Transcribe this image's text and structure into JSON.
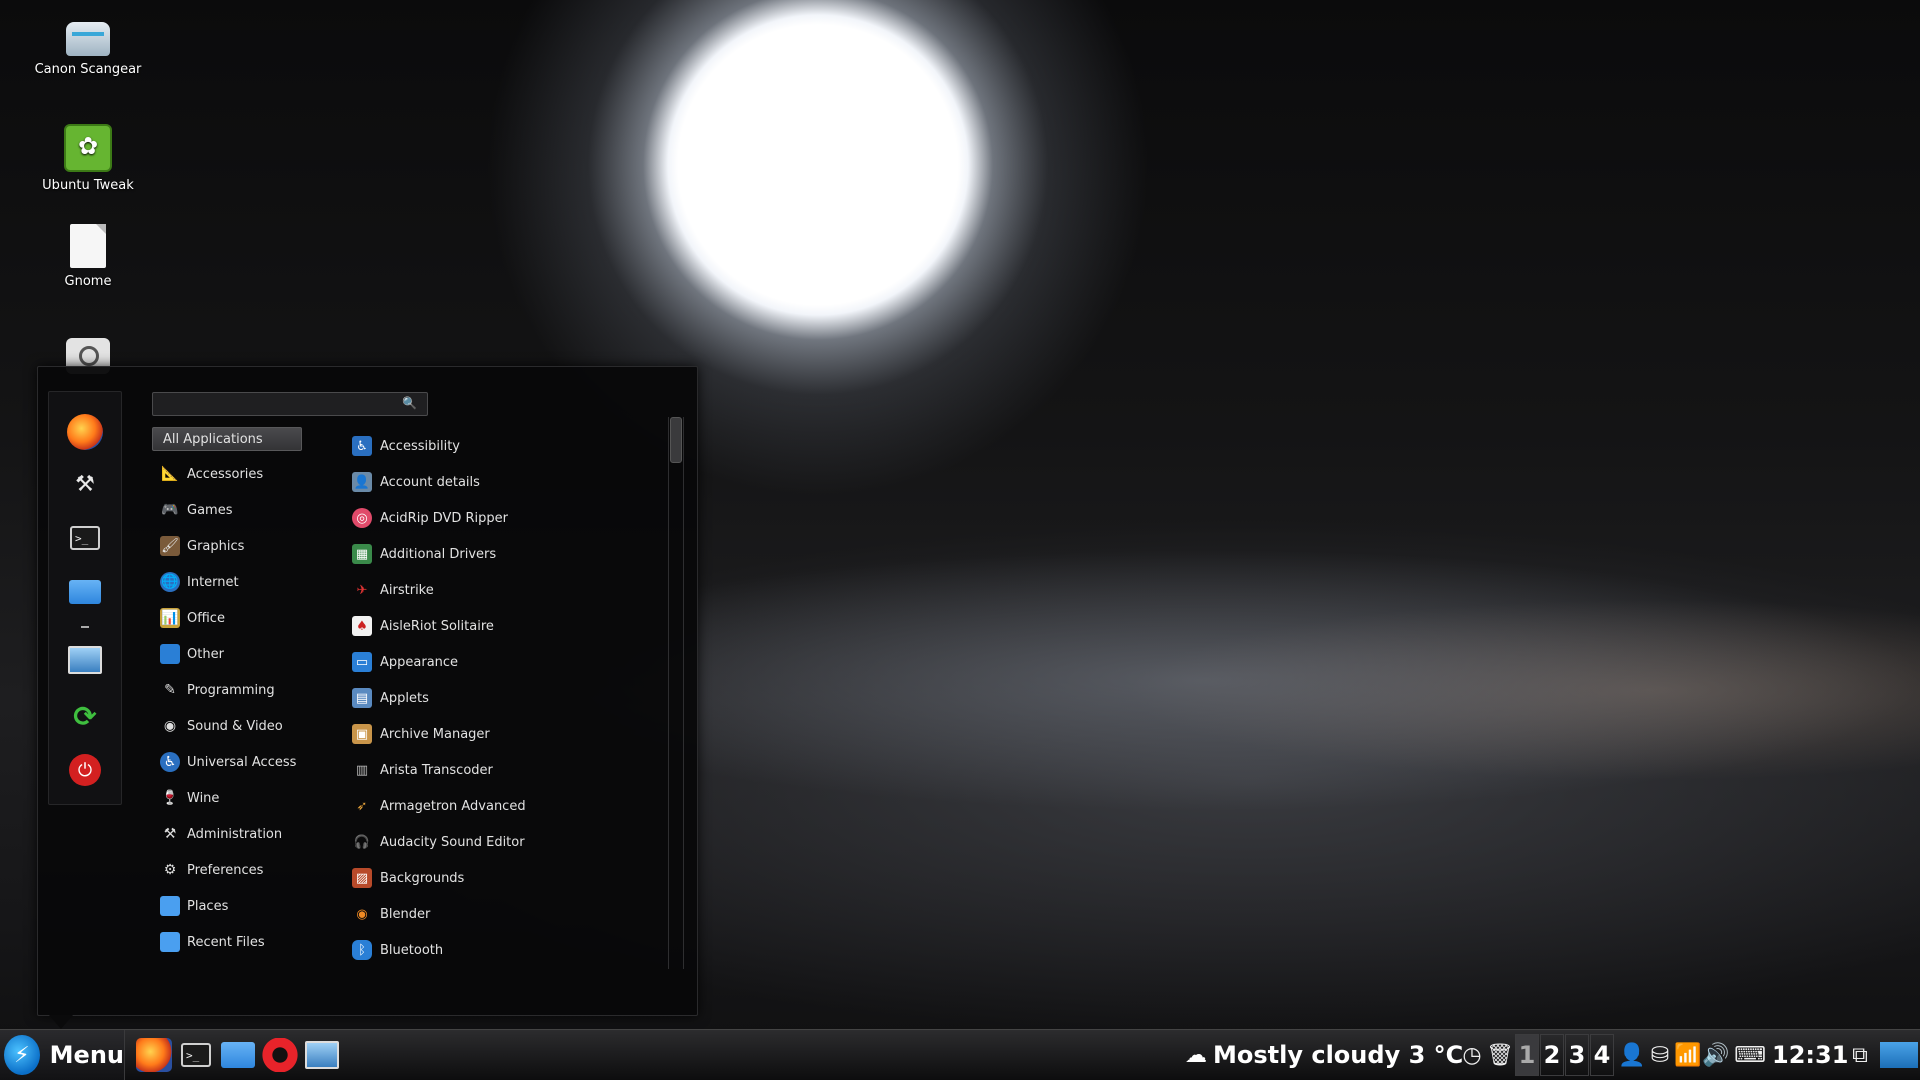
{
  "desktop": {
    "icons": [
      {
        "label": "Canon Scangear",
        "icon": "scanner-icon"
      },
      {
        "label": "Ubuntu Tweak",
        "icon": "ubuntu-tweak-icon"
      },
      {
        "label": "Gnome",
        "icon": "document-icon"
      }
    ]
  },
  "menu": {
    "search": {
      "value": "",
      "placeholder": ""
    },
    "favorites": [
      "firefox-icon",
      "tools-icon",
      "terminal-icon",
      "folder-icon",
      "screen-icon",
      "logout-icon",
      "power-icon"
    ],
    "categories": [
      "All Applications",
      "Accessories",
      "Games",
      "Graphics",
      "Internet",
      "Office",
      "Other",
      "Programming",
      "Sound & Video",
      "Universal Access",
      "Wine",
      "Administration",
      "Preferences",
      "Places",
      "Recent Files"
    ],
    "selected_category": "All Applications",
    "apps": [
      "Accessibility",
      "Account details",
      "AcidRip DVD Ripper",
      "Additional Drivers",
      "Airstrike",
      "AisleRiot Solitaire",
      "Appearance",
      "Applets",
      "Archive Manager",
      "Arista Transcoder",
      "Armagetron Advanced",
      "Audacity Sound Editor",
      "Backgrounds",
      "Blender",
      "Bluetooth"
    ]
  },
  "taskbar": {
    "menu_label": "Menu",
    "weather": "Mostly cloudy 3 °C",
    "workspaces": [
      "1",
      "2",
      "3",
      "4"
    ],
    "active_workspace": "1",
    "clock": "12:31"
  },
  "colors": {
    "accent": "#2e86de",
    "panel_bg": "#0a0a0b",
    "power": "#d32020",
    "logout": "#3fbf3f"
  }
}
